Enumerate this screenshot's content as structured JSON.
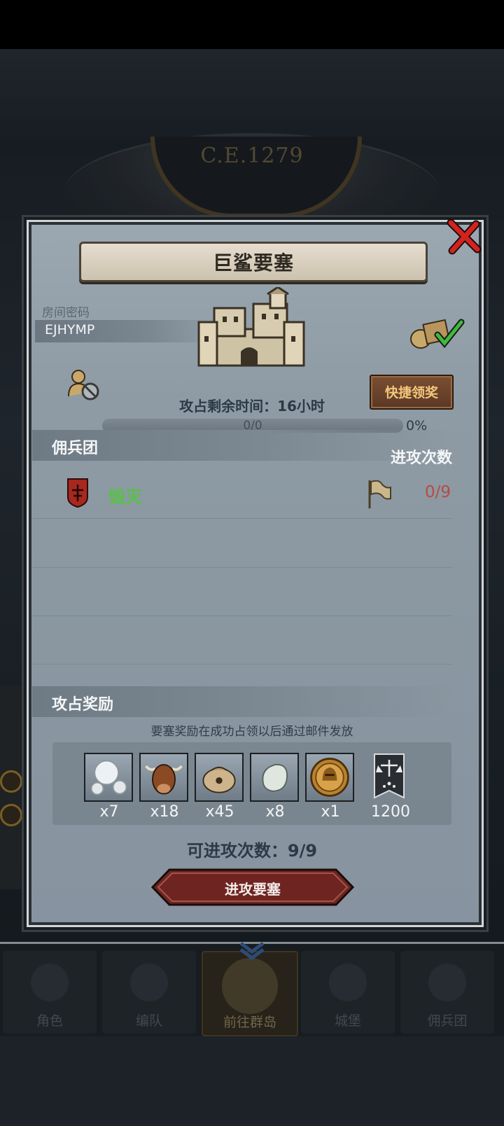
{
  "background": {
    "year": "C.E.1279"
  },
  "modal": {
    "title": "巨鲨要塞",
    "room_label": "房间密码",
    "room_code": "EJHYMP",
    "quick_claim_label": "快捷领奖",
    "time_text": "攻占剩余时间：16小时",
    "progress": {
      "text": "0/0",
      "percent_label": "0%",
      "fraction": 0
    },
    "mercenary_header": "佣兵团",
    "attack_count_header": "进攻次数",
    "teams": [
      {
        "name": "毁灭",
        "count": "0/9"
      }
    ],
    "rewards_header": "攻占奖励",
    "rewards_note": "要塞奖励在成功占领以后通过邮件发放",
    "rewards": [
      {
        "icon": "pearl-icon",
        "qty": "x7"
      },
      {
        "icon": "ox-icon",
        "qty": "x18"
      },
      {
        "icon": "sack-icon",
        "qty": "x45"
      },
      {
        "icon": "stone-icon",
        "qty": "x8"
      },
      {
        "icon": "knight-coin-icon",
        "qty": "x1"
      },
      {
        "icon": "justice-banner-icon",
        "qty": "1200"
      }
    ],
    "attempts_text": "可进攻次数：9/9",
    "attack_button_label": "进攻要塞"
  },
  "bottom_nav": [
    {
      "label": "角色",
      "active": false
    },
    {
      "label": "编队",
      "active": false
    },
    {
      "label": "前往群岛",
      "active": true
    },
    {
      "label": "城堡",
      "active": false
    },
    {
      "label": "佣兵团",
      "active": false
    }
  ],
  "colors": {
    "accent_green": "#58c243",
    "count_red": "#b84a43",
    "quick_btn_text": "#f2c77c"
  }
}
